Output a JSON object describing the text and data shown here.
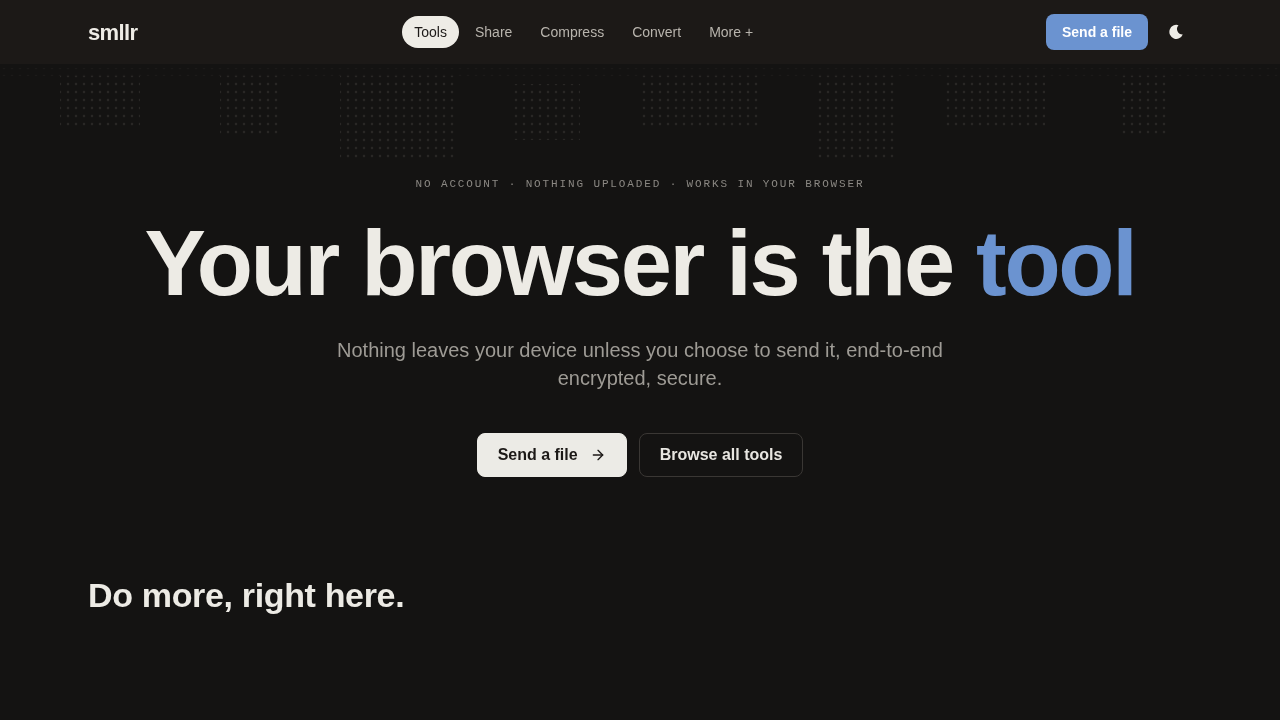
{
  "header": {
    "logo": "smllr",
    "nav": [
      {
        "label": "Tools",
        "selected": true
      },
      {
        "label": "Share",
        "selected": false
      },
      {
        "label": "Compress",
        "selected": false
      },
      {
        "label": "Convert",
        "selected": false
      },
      {
        "label": "More +",
        "selected": false
      }
    ],
    "cta": "Send a file"
  },
  "hero": {
    "eyebrow": "NO ACCOUNT · NOTHING UPLOADED · WORKS IN YOUR BROWSER",
    "headline": "Your browser is the",
    "headline_accent": "tool",
    "subtitle": "Nothing leaves your device unless you choose to send it, end-to-end encrypted, secure.",
    "buttons": [
      {
        "label": "Send a file",
        "kind": "primary"
      },
      {
        "label": "Browse all tools",
        "kind": "secondary"
      }
    ]
  },
  "section": {
    "heading": "Do more, right here."
  }
}
